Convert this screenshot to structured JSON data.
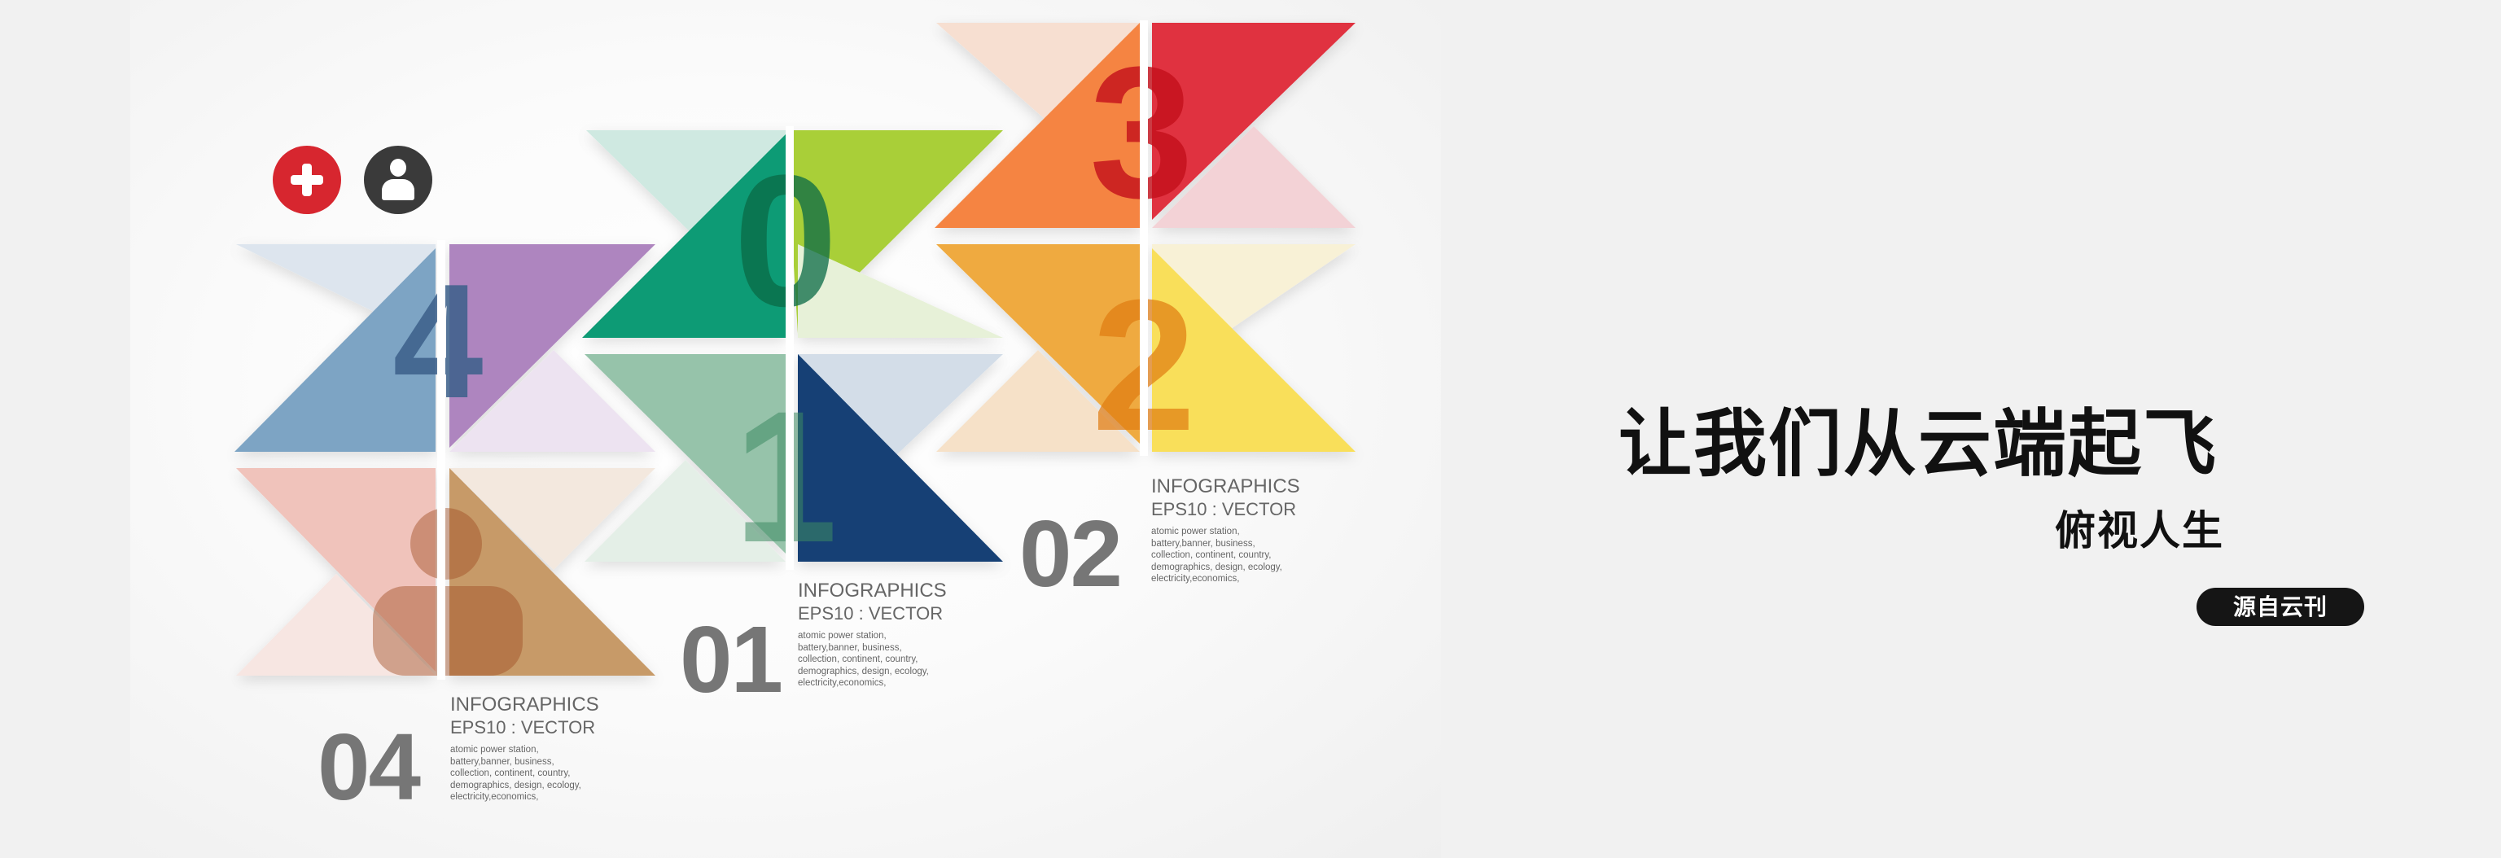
{
  "headline": "让我们从云端起飞",
  "subheadline": "俯视人生",
  "badge": "源自云刊",
  "icons": {
    "plus": "plus-icon",
    "user": "user-icon"
  },
  "tiles": [
    {
      "digit": "0",
      "colors": [
        "#0e9b74",
        "#a9cf38"
      ]
    },
    {
      "digit": "3",
      "colors": [
        "#f58442",
        "#e0303f"
      ]
    },
    {
      "digit": "2",
      "colors": [
        "#efaa3f",
        "#f9df5a"
      ]
    },
    {
      "digit": "1",
      "colors": [
        "#96c3aa",
        "#123f74"
      ]
    },
    {
      "digit": "4",
      "colors": [
        "#7da4c4",
        "#ae85bf"
      ]
    }
  ],
  "infographics": [
    {
      "number": "01",
      "title": "INFOGRAPHICS",
      "subtitle": "EPS10 : VECTOR",
      "body": "atomic power station, battery,banner, business, collection, continent, country, demographics, design, ecology, electricity,economics,"
    },
    {
      "number": "02",
      "title": "INFOGRAPHICS",
      "subtitle": "EPS10 : VECTOR",
      "body": "atomic power station, battery,banner, business, collection, continent, country, demographics, design, ecology, electricity,economics,"
    },
    {
      "number": "04",
      "title": "INFOGRAPHICS",
      "subtitle": "EPS10 : VECTOR",
      "body": "atomic power station, battery,banner, business, collection, continent, country, demographics, design, ecology, electricity,economics,"
    }
  ]
}
